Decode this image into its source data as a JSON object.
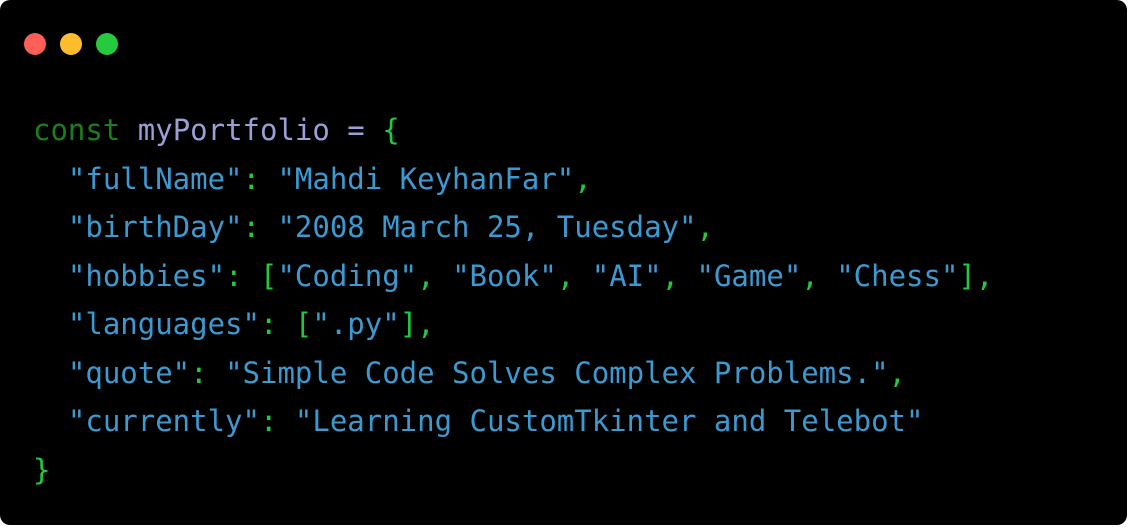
{
  "window": {
    "buttons": [
      {
        "name": "close",
        "color": "#ff5f56"
      },
      {
        "name": "minimize",
        "color": "#ffbd2e"
      },
      {
        "name": "maximize",
        "color": "#27c93f"
      }
    ]
  },
  "colors": {
    "background": "#000000",
    "keyword": "#1a7f1a",
    "identifier": "#9aa0d6",
    "punctuation": "#22c940",
    "string": "#3d9ad1"
  },
  "code": {
    "keyword": "const",
    "variable": "myPortfolio",
    "assign": " = ",
    "open_brace": "{",
    "close_brace": "}",
    "fields": {
      "fullName": {
        "key": "\"fullName\"",
        "value": "\"Mahdi KeyhanFar\""
      },
      "birthDay": {
        "key": "\"birthDay\"",
        "value": "\"2008 March 25, Tuesday\""
      },
      "hobbies": {
        "key": "\"hobbies\"",
        "values": [
          "\"Coding\"",
          "\"Book\"",
          "\"AI\"",
          "\"Game\"",
          "\"Chess\""
        ]
      },
      "languages": {
        "key": "\"languages\"",
        "values": [
          "\".py\""
        ]
      },
      "quote": {
        "key": "\"quote\"",
        "value": "\"Simple Code Solves Complex Problems.\""
      },
      "currently": {
        "key": "\"currently\"",
        "value": "\"Learning CustomTkinter and Telebot\""
      }
    }
  }
}
